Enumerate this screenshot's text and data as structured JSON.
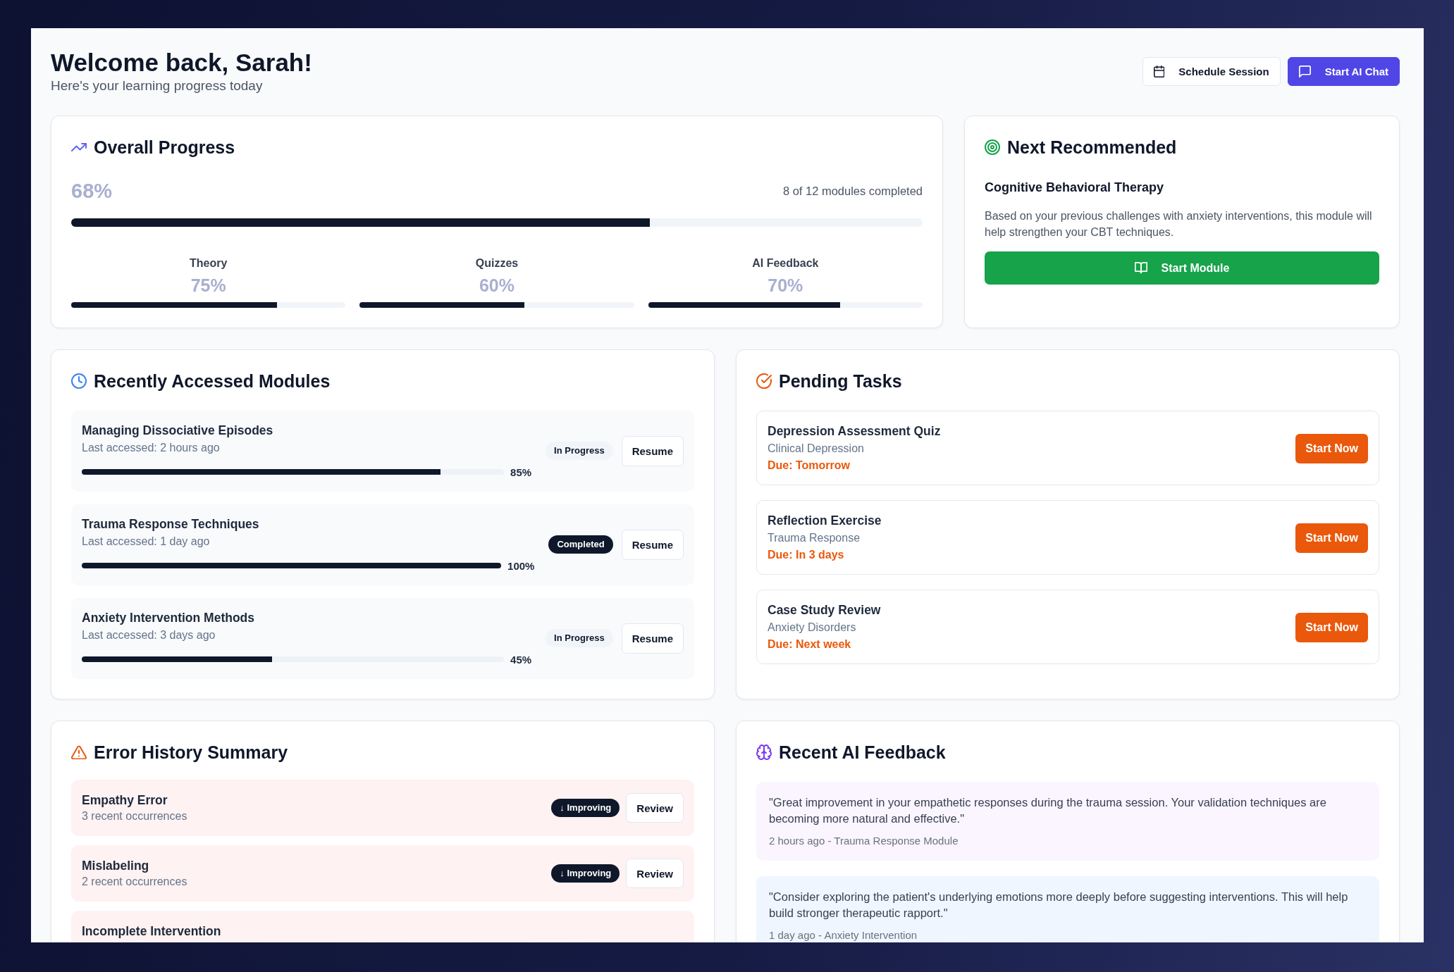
{
  "header": {
    "title": "Welcome back, Sarah!",
    "subtitle": "Here's your learning progress today",
    "buttons": [
      {
        "label": "Schedule Session",
        "kind": "outline"
      },
      {
        "label": "Start AI Chat",
        "kind": "primary"
      }
    ]
  },
  "overall_progress": {
    "title": "Overall Progress",
    "percent": "68%",
    "summary": "8 of 12 modules completed",
    "level": 0.68,
    "categories": [
      {
        "label": "Theory",
        "percent": "75%",
        "level": 0.75
      },
      {
        "label": "Quizzes",
        "percent": "60%",
        "level": 0.6
      },
      {
        "label": "AI Feedback",
        "percent": "70%",
        "level": 0.7
      }
    ]
  },
  "next_recommended": {
    "title": "Next Recommended",
    "module": "Cognitive Behavioral Therapy",
    "description": "Based on your previous challenges with anxiety interventions, this module will help strengthen your CBT techniques.",
    "button": "Start Module"
  },
  "recent_modules": {
    "title": "Recently Accessed Modules",
    "items": [
      {
        "name": "Managing Dissociative Episodes",
        "last_accessed": "Last accessed: 2 hours ago",
        "level": 0.85,
        "percent": "85%",
        "badge": {
          "label": "In Progress",
          "kind": "in_progress"
        },
        "button": "Resume"
      },
      {
        "name": "Trauma Response Techniques",
        "last_accessed": "Last accessed: 1 day ago",
        "level": 1.0,
        "percent": "100%",
        "badge": {
          "label": "Completed",
          "kind": "completed"
        },
        "button": "Resume"
      },
      {
        "name": "Anxiety Intervention Methods",
        "last_accessed": "Last accessed: 3 days ago",
        "level": 0.45,
        "percent": "45%",
        "badge": {
          "label": "In Progress",
          "kind": "in_progress"
        },
        "button": "Resume"
      }
    ]
  },
  "pending_tasks": {
    "title": "Pending Tasks",
    "items": [
      {
        "name": "Depression Assessment Quiz",
        "category": "Clinical Depression",
        "due": "Due: Tomorrow",
        "button": "Start Now"
      },
      {
        "name": "Reflection Exercise",
        "category": "Trauma Response",
        "due": "Due: In 3 days",
        "button": "Start Now"
      },
      {
        "name": "Case Study Review",
        "category": "Anxiety Disorders",
        "due": "Due: Next week",
        "button": "Start Now"
      }
    ]
  },
  "error_history": {
    "title": "Error History Summary",
    "items": [
      {
        "name": "Empathy Error",
        "occurrences": "3 recent occurrences",
        "badge": "↓ Improving",
        "button": "Review"
      },
      {
        "name": "Mislabeling",
        "occurrences": "2 recent occurrences",
        "badge": "↓ Improving",
        "button": "Review"
      },
      {
        "name": "Incomplete Intervention"
      }
    ]
  },
  "ai_feedback": {
    "title": "Recent AI Feedback",
    "items": [
      {
        "quote": "\"Great improvement in your empathetic responses during the trauma session. Your validation techniques are becoming more natural and effective.\"",
        "meta": "2 hours ago - Trauma Response Module",
        "color": "#faf5ff"
      },
      {
        "quote": "\"Consider exploring the patient's underlying emotions more deeply before suggesting interventions. This will help build stronger therapeutic rapport.\"",
        "meta": "1 day ago - Anxiety Intervention",
        "color": "#eff6ff"
      }
    ]
  }
}
